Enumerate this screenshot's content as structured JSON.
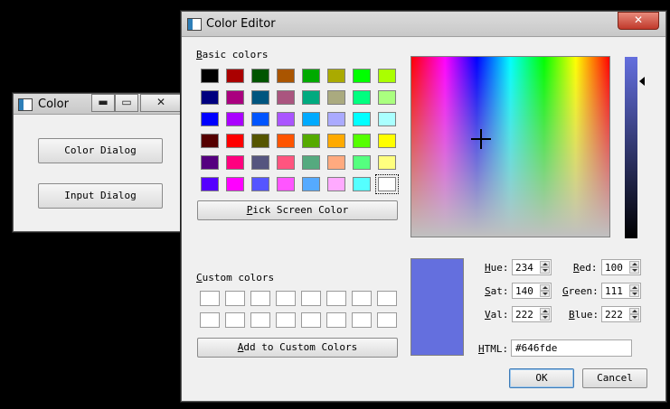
{
  "small_window": {
    "title": "Color",
    "buttons": {
      "color_dialog": "Color Dialog",
      "input_dialog": "Input Dialog"
    },
    "caption": {
      "minimize": "▬",
      "maximize": "▭",
      "close": "✕"
    }
  },
  "editor": {
    "title": "Color Editor",
    "close_glyph": "✕",
    "basic_colors_label": {
      "accel": "B",
      "rest": "asic colors"
    },
    "pick_screen_color": {
      "accel": "P",
      "rest": "ick Screen Color"
    },
    "custom_colors_label": {
      "accel": "C",
      "rest": "ustom colors"
    },
    "add_custom": {
      "accel": "A",
      "rest": "dd to Custom Colors"
    },
    "basic_colors": [
      "#000000",
      "#aa0000",
      "#005500",
      "#aa5500",
      "#00aa00",
      "#aaaa00",
      "#00ff00",
      "#aaff00",
      "#00007f",
      "#aa007f",
      "#00557f",
      "#aa557f",
      "#00aa7f",
      "#aaaa7f",
      "#00ff7f",
      "#aaff7f",
      "#0000ff",
      "#aa00ff",
      "#0055ff",
      "#aa55ff",
      "#00aaff",
      "#aaaaff",
      "#00ffff",
      "#aaffff",
      "#550000",
      "#ff0000",
      "#555500",
      "#ff5500",
      "#55aa00",
      "#ffaa00",
      "#55ff00",
      "#ffff00",
      "#55007f",
      "#ff007f",
      "#55557f",
      "#ff557f",
      "#55aa7f",
      "#ffaa7f",
      "#55ff7f",
      "#ffff7f",
      "#5500ff",
      "#ff00ff",
      "#5555ff",
      "#ff55ff",
      "#55aaff",
      "#ffaaff",
      "#55ffff",
      "#ffffff"
    ],
    "selected_basic_index": 47,
    "custom_count": 16,
    "current_color": "#646fde",
    "fields": {
      "hue": {
        "accel": "H",
        "rest": "ue:",
        "value": "234"
      },
      "sat": {
        "accel": "S",
        "rest": "at:",
        "value": "140"
      },
      "val": {
        "accel": "V",
        "rest": "al:",
        "value": "222"
      },
      "red": {
        "accel": "R",
        "rest": "ed:",
        "value": "100"
      },
      "green": {
        "accel": "G",
        "rest": "reen:",
        "value": "111"
      },
      "blue": {
        "accel": "B",
        "rest": "lue:",
        "value": "222"
      }
    },
    "html": {
      "accel": "H",
      "rest": "TML:",
      "value": "#646fde"
    },
    "ok": "OK",
    "cancel": "Cancel",
    "crosshair_glyph": "+"
  }
}
